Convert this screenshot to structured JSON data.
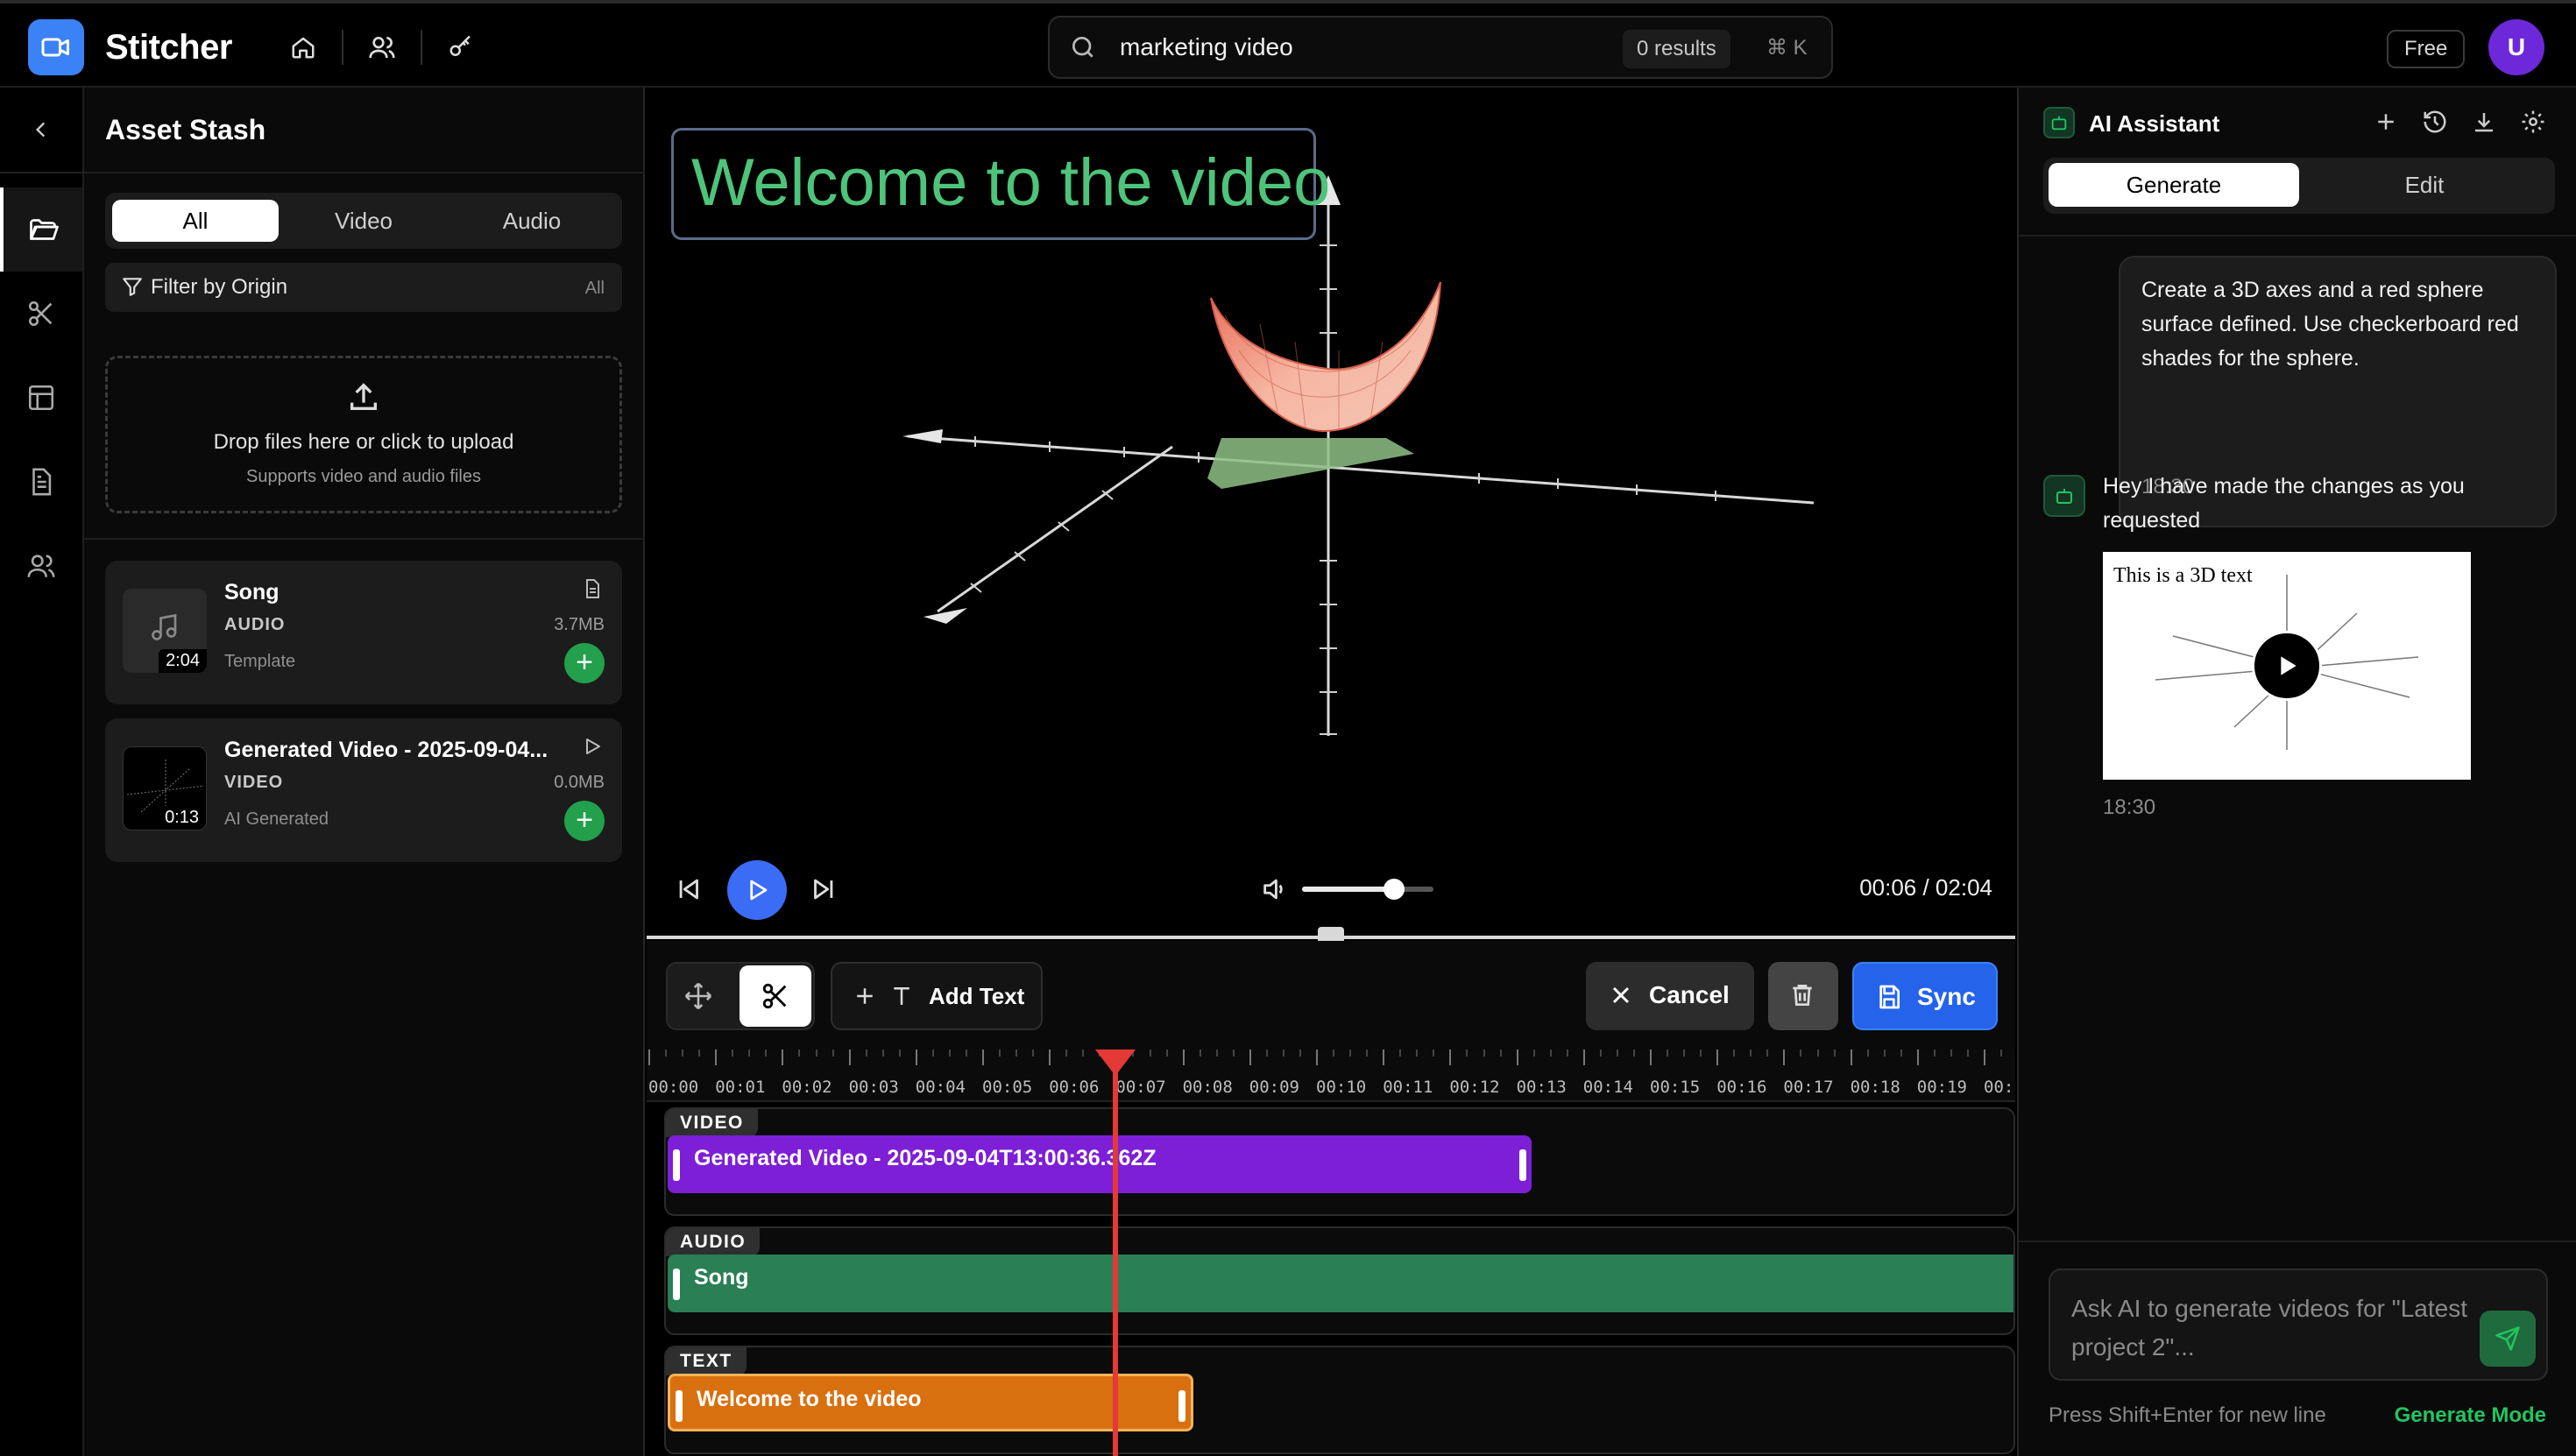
{
  "app": {
    "title": "Stitcher"
  },
  "search": {
    "value": "marketing video",
    "results": "0 results",
    "shortcut": "⌘ K"
  },
  "account": {
    "plan": "Free",
    "avatar_initial": "U"
  },
  "asset_stash": {
    "title": "Asset Stash",
    "tabs": [
      "All",
      "Video",
      "Audio"
    ],
    "active_tab": "All",
    "filter_label": "Filter by Origin",
    "filter_value": "All",
    "upload_title": "Drop files here or click to upload",
    "upload_subtitle": "Supports video and audio files",
    "items": [
      {
        "name": "Song",
        "type": "AUDIO",
        "size": "3.7MB",
        "origin": "Template",
        "duration": "2:04",
        "icon": "document-icon"
      },
      {
        "name": "Generated Video - 2025-09-04...",
        "type": "VIDEO",
        "size": "0.0MB",
        "origin": "AI Generated",
        "duration": "0:13",
        "icon": "play-outline-icon"
      }
    ]
  },
  "preview": {
    "overlay_text": "Welcome to the video",
    "current_time": "00:06 / 02:04",
    "volume": 0.7
  },
  "toolbar": {
    "add_text": "Add Text",
    "cancel": "Cancel",
    "sync": "Sync"
  },
  "timeline": {
    "ticks": [
      "00:00",
      "00:01",
      "00:02",
      "00:03",
      "00:04",
      "00:05",
      "00:06",
      "00:07",
      "00:08",
      "00:09",
      "00:10",
      "00:11",
      "00:12",
      "00:13",
      "00:14",
      "00:15",
      "00:16",
      "00:17",
      "00:18",
      "00:19",
      "00:"
    ],
    "tracks": [
      {
        "tag": "VIDEO",
        "clip": "Generated Video - 2025-09-04T13:00:36.362Z",
        "color": "#7c1fd6"
      },
      {
        "tag": "AUDIO",
        "clip": "Song",
        "color": "#2a7f55"
      },
      {
        "tag": "TEXT",
        "clip": "Welcome to the video",
        "color": "#d9700f"
      }
    ]
  },
  "ai_assistant": {
    "title": "AI Assistant",
    "tabs": [
      "Generate",
      "Edit"
    ],
    "active_tab": "Generate",
    "user_message": "Create a 3D axes and a red sphere surface defined. Use checkerboard red shades for the sphere.",
    "user_time": "18:30",
    "bot_message": "Hey I have made the changes as you requested",
    "bot_video_caption": "This is a 3D text",
    "bot_time": "18:30",
    "input_placeholder": "Ask AI to generate videos for \"Latest project 2\"...",
    "hint": "Press Shift+Enter for new line",
    "mode": "Generate Mode"
  },
  "colors": {
    "accent": "#3b82f6",
    "brand": "#3b82f6",
    "add_green": "#22a04b",
    "playhead": "#e53935",
    "overlay_text": "#4ec47a"
  }
}
